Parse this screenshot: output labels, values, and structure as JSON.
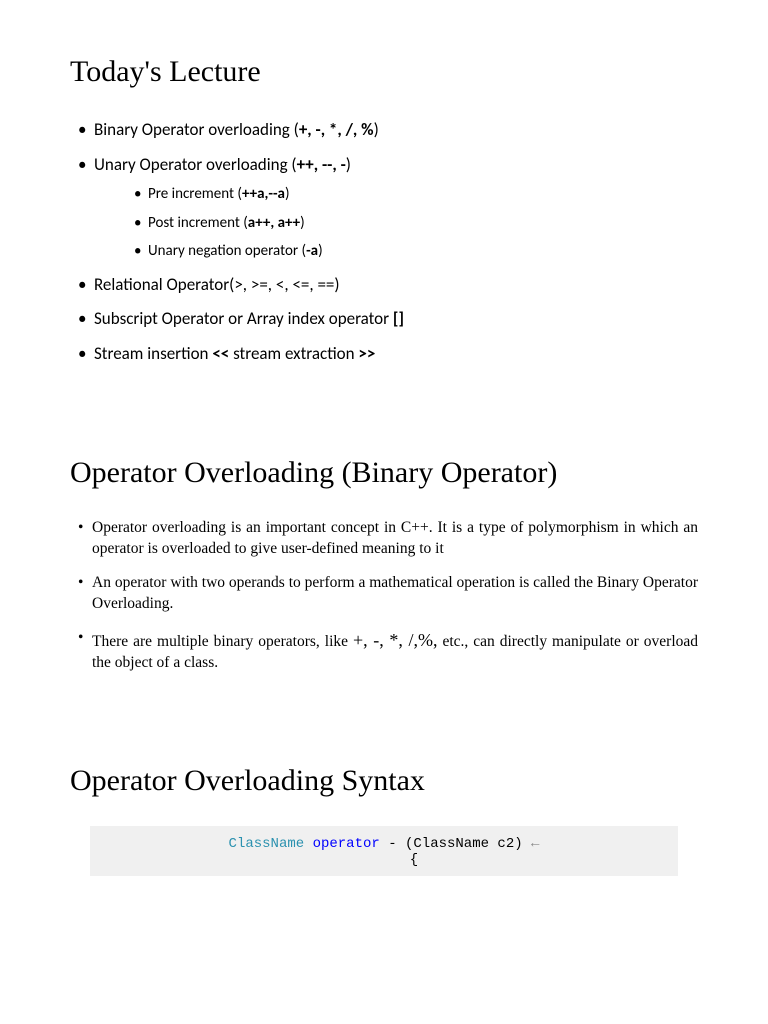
{
  "section1": {
    "heading": "Today's Lecture",
    "items": [
      {
        "prefix": "Binary Operator overloading (",
        "bold": "+, -, *, /, %",
        "suffix": ")"
      },
      {
        "prefix": "Unary Operator overloading (",
        "bold": "++, --, -",
        "suffix": ")",
        "subitems": [
          {
            "prefix": "Pre increment (",
            "bold": "++a,--a",
            "suffix": ")"
          },
          {
            "prefix": "Post increment (",
            "bold": "a++, a++",
            "suffix": ")"
          },
          {
            "prefix": "Unary negation operator (",
            "bold": "-a",
            "suffix": ")"
          }
        ]
      },
      {
        "text": "Relational Operator(>, >=, <, <=, ==)"
      },
      {
        "prefix": "Subscript Operator or Array index operator ",
        "bold": "[]",
        "suffix": ""
      },
      {
        "prefix": "Stream insertion ",
        "bold1": "<<",
        "mid": " stream extraction ",
        "bold2": ">>"
      }
    ]
  },
  "section2": {
    "heading": "Operator Overloading (Binary Operator)",
    "items": [
      "Operator overloading is an important concept in C++. It is a type of polymorphism in which an operator is overloaded to give user-defined meaning to it",
      "An operator with two operands to perform a mathematical operation is called the Binary Operator Overloading.",
      {
        "prefix": "There are multiple binary operators, like ",
        "ops": "+, -, *, /,%,",
        "suffix": " etc., can directly manipulate or overload the object of a class."
      }
    ]
  },
  "section3": {
    "heading": "Operator Overloading Syntax",
    "code": {
      "classname": "ClassName",
      "keyword": "operator",
      "rest": " - (ClassName c2) ",
      "arrow": "←",
      "brace": "{"
    }
  }
}
